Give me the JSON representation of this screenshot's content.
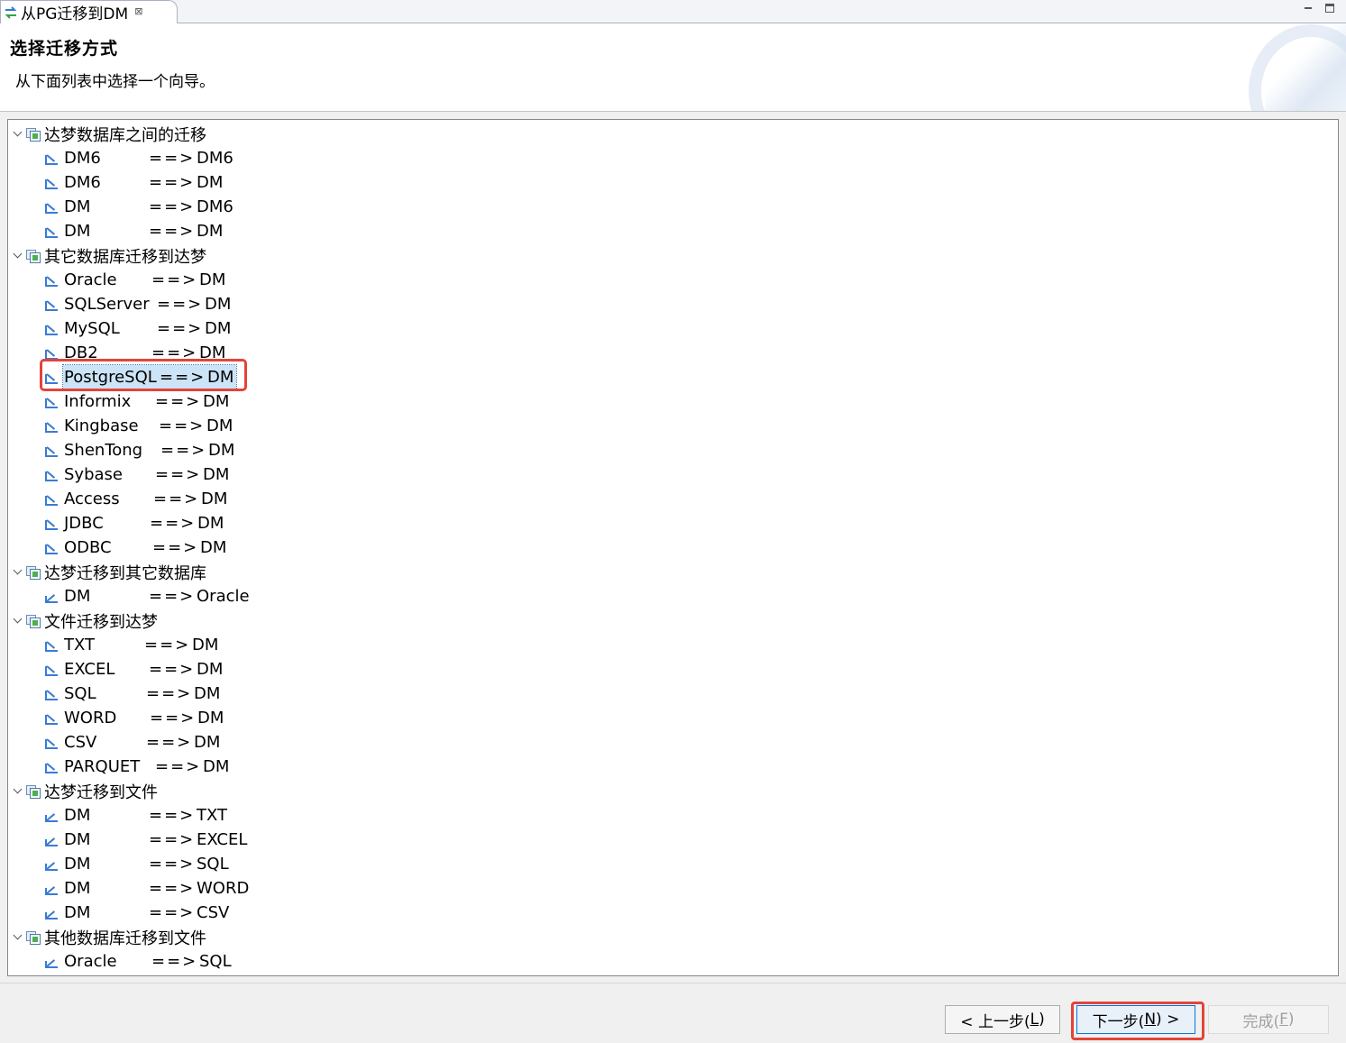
{
  "tab": {
    "title": "从PG迁移到DM",
    "close_glyph": "⊠"
  },
  "header": {
    "title": "选择迁移方式",
    "description": "从下面列表中选择一个向导。"
  },
  "tree": {
    "arrow": "==>",
    "groups": [
      {
        "label": "达梦数据库之间的迁移",
        "items": [
          {
            "src": "DM6",
            "dst": "DM6",
            "dir": "in"
          },
          {
            "src": "DM6",
            "dst": "DM",
            "dir": "in"
          },
          {
            "src": "DM",
            "dst": "DM6",
            "dir": "in"
          },
          {
            "src": "DM",
            "dst": "DM",
            "dir": "in"
          }
        ]
      },
      {
        "label": "其它数据库迁移到达梦",
        "items": [
          {
            "src": "Oracle",
            "dst": "DM",
            "dir": "in"
          },
          {
            "src": "SQLServer",
            "dst": "DM",
            "dir": "in"
          },
          {
            "src": "MySQL",
            "dst": "DM",
            "dir": "in"
          },
          {
            "src": "DB2",
            "dst": "DM",
            "dir": "in"
          },
          {
            "src": "PostgreSQL",
            "dst": "DM",
            "dir": "in",
            "selected": true
          },
          {
            "src": "Informix",
            "dst": "DM",
            "dir": "in"
          },
          {
            "src": "Kingbase",
            "dst": "DM",
            "dir": "in"
          },
          {
            "src": "ShenTong",
            "dst": "DM",
            "dir": "in"
          },
          {
            "src": "Sybase",
            "dst": "DM",
            "dir": "in"
          },
          {
            "src": "Access",
            "dst": "DM",
            "dir": "in"
          },
          {
            "src": "JDBC",
            "dst": "DM",
            "dir": "in"
          },
          {
            "src": "ODBC",
            "dst": "DM",
            "dir": "in"
          }
        ]
      },
      {
        "label": "达梦迁移到其它数据库",
        "items": [
          {
            "src": "DM",
            "dst": "Oracle",
            "dir": "out"
          }
        ]
      },
      {
        "label": "文件迁移到达梦",
        "items": [
          {
            "src": "TXT",
            "dst": "DM",
            "dir": "in"
          },
          {
            "src": "EXCEL",
            "dst": "DM",
            "dir": "in"
          },
          {
            "src": "SQL",
            "dst": "DM",
            "dir": "in"
          },
          {
            "src": "WORD",
            "dst": "DM",
            "dir": "in"
          },
          {
            "src": "CSV",
            "dst": "DM",
            "dir": "in"
          },
          {
            "src": "PARQUET",
            "dst": "DM",
            "dir": "in"
          }
        ]
      },
      {
        "label": "达梦迁移到文件",
        "items": [
          {
            "src": "DM",
            "dst": "TXT",
            "dir": "out"
          },
          {
            "src": "DM",
            "dst": "EXCEL",
            "dir": "out"
          },
          {
            "src": "DM",
            "dst": "SQL",
            "dir": "out"
          },
          {
            "src": "DM",
            "dst": "WORD",
            "dir": "out"
          },
          {
            "src": "DM",
            "dst": "CSV",
            "dir": "out"
          }
        ]
      },
      {
        "label": "其他数据库迁移到文件",
        "items": [
          {
            "src": "Oracle",
            "dst": "SQL",
            "dir": "out"
          }
        ]
      }
    ]
  },
  "footer": {
    "back": {
      "pre": "< 上一步(",
      "key": "L",
      "post": ")"
    },
    "next": {
      "pre": "下一步(",
      "key": "N",
      "post": ") >"
    },
    "finish": {
      "pre": "完成(",
      "key": "F",
      "post": ")"
    }
  },
  "colors": {
    "selection": "#cce4f7",
    "annotation": "#e3443a",
    "icon_blue": "#3a7bd5"
  }
}
